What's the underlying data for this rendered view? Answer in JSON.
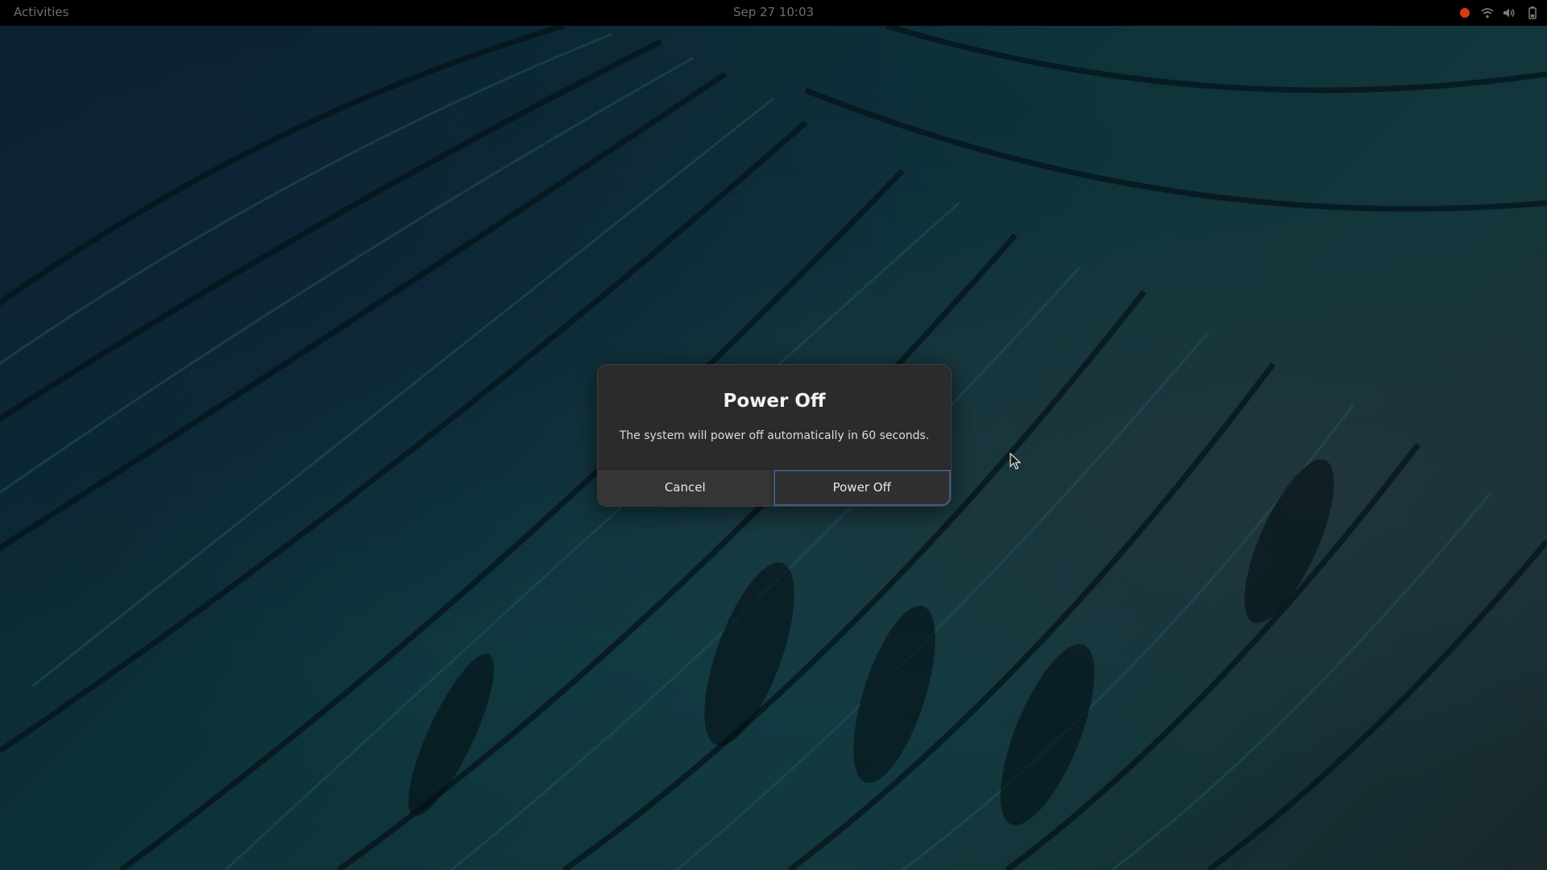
{
  "topbar": {
    "activities_label": "Activities",
    "clock": "Sep 27  10:03",
    "tray_icons": [
      "record-indicator-icon",
      "wifi-icon",
      "volume-icon",
      "battery-icon"
    ],
    "record_color": "#d93c15"
  },
  "dialog": {
    "title": "Power Off",
    "description": "The system will power off automatically in 60 seconds.",
    "cancel_label": "Cancel",
    "confirm_label": "Power Off",
    "focus_color": "#3e5d86"
  }
}
